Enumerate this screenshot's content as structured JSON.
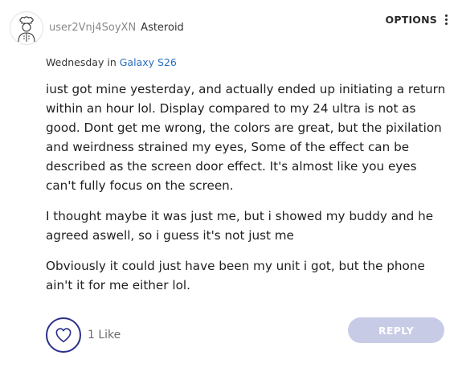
{
  "author": {
    "username": "user2Vnj4SoyXN",
    "rank": "Asteroid",
    "avatar_icon": "chef-avatar-icon"
  },
  "options": {
    "label": "OPTIONS",
    "icon": "kebab-menu-icon"
  },
  "posted": {
    "day": "Wednesday",
    "in_text": "in",
    "board": "Galaxy S26"
  },
  "body": {
    "paragraphs": [
      "iust got mine yesterday, and actually ended up initiating a return within an hour lol. Display compared to my 24 ultra is not as good. Dont get me wrong, the colors are great, but the pixilation and weirdness strained my eyes, Some of the effect can be described as the screen door effect. It's almost like you eyes can't fully focus on the screen.",
      "I thought maybe it was just me, but i showed my buddy and he agreed aswell, so i guess it's not just me",
      "Obviously it could just have been my unit i got, but the phone ain't it for me either lol."
    ]
  },
  "actions": {
    "like_count_label": "1 Like",
    "like_icon": "heart-icon",
    "reply_label": "REPLY"
  },
  "colors": {
    "link": "#2a6fbf",
    "like_ring": "#2b2f8c",
    "reply_bg": "#c8cbe6"
  }
}
